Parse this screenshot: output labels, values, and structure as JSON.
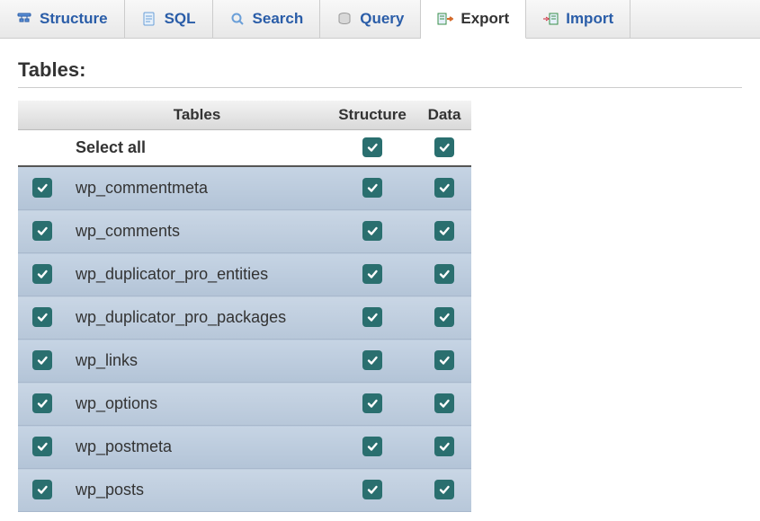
{
  "tabs": [
    {
      "label": "Structure",
      "icon": "structure-icon",
      "active": false
    },
    {
      "label": "SQL",
      "icon": "sql-icon",
      "active": false
    },
    {
      "label": "Search",
      "icon": "search-icon",
      "active": false
    },
    {
      "label": "Query",
      "icon": "query-icon",
      "active": false
    },
    {
      "label": "Export",
      "icon": "export-icon",
      "active": true
    },
    {
      "label": "Import",
      "icon": "import-icon",
      "active": false
    }
  ],
  "section_title": "Tables:",
  "columns": {
    "name": "Tables",
    "structure": "Structure",
    "data": "Data"
  },
  "select_all": {
    "label": "Select all",
    "structure_checked": true,
    "data_checked": true
  },
  "rows": [
    {
      "name": "wp_commentmeta",
      "selected": true,
      "structure_checked": true,
      "data_checked": true
    },
    {
      "name": "wp_comments",
      "selected": true,
      "structure_checked": true,
      "data_checked": true
    },
    {
      "name": "wp_duplicator_pro_entities",
      "selected": true,
      "structure_checked": true,
      "data_checked": true
    },
    {
      "name": "wp_duplicator_pro_packages",
      "selected": true,
      "structure_checked": true,
      "data_checked": true
    },
    {
      "name": "wp_links",
      "selected": true,
      "structure_checked": true,
      "data_checked": true
    },
    {
      "name": "wp_options",
      "selected": true,
      "structure_checked": true,
      "data_checked": true
    },
    {
      "name": "wp_postmeta",
      "selected": true,
      "structure_checked": true,
      "data_checked": true
    },
    {
      "name": "wp_posts",
      "selected": true,
      "structure_checked": true,
      "data_checked": true
    }
  ]
}
